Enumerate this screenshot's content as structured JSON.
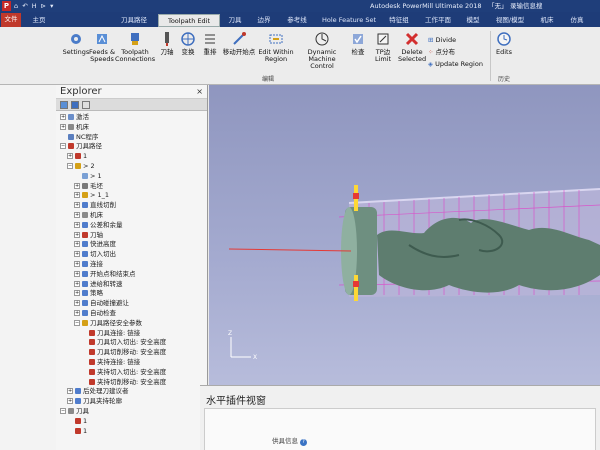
{
  "app": {
    "title": "Autodesk PowerMill Ultimate 2018",
    "title_suffix": "「无」",
    "right_text": "录输信息搜",
    "logo": "P",
    "quick_access": "⌂ ↶ H ⊳ ▾"
  },
  "tabs": [
    {
      "label": "文件"
    },
    {
      "label": "主页"
    },
    {
      "label": "刀具路径"
    },
    {
      "label": "Toolpath Edit"
    },
    {
      "label": "刀具"
    },
    {
      "label": "边界"
    },
    {
      "label": "参考线"
    },
    {
      "label": "Hole Feature Set"
    },
    {
      "label": "特征组"
    },
    {
      "label": "工作平面"
    },
    {
      "label": "模型"
    },
    {
      "label": "视图/模型"
    },
    {
      "label": "机床"
    },
    {
      "label": "仿真"
    }
  ],
  "ribbon": {
    "settings": "Settings",
    "feeds_speeds": "Feeds & Speeds",
    "toolpath_connections": "Toolpath Connections",
    "tool_axis": "刀轴",
    "transform": "变换",
    "reorder": "重排",
    "move_start": "移动开始点",
    "edit_within_region": "Edit Within Region",
    "dynamic_machine_control": "Dynamic Machine Control",
    "check": "检查",
    "tp_limit": "TP边Limit",
    "delete_selected": "Delete Selected",
    "divide": "Divide",
    "distribute": "点分布",
    "update_region": "Update Region",
    "edits": "Edits",
    "group_edit": "编辑",
    "group_history": "历史"
  },
  "explorer": {
    "title": "Explorer",
    "close": "×",
    "tree": [
      {
        "label": "激活",
        "indent": 0,
        "expander": "+",
        "icon": "#6b8ec9"
      },
      {
        "label": "机床",
        "indent": 0,
        "expander": "+",
        "icon": "#8a8a8a"
      },
      {
        "label": "NC程序",
        "indent": 0,
        "expander": "",
        "icon": "#5b7fbf"
      },
      {
        "label": "刀具路径",
        "indent": 0,
        "expander": "−",
        "icon": "#c0392b"
      },
      {
        "label": "1",
        "indent": 1,
        "expander": "+",
        "icon": "#c0392b"
      },
      {
        "label": "> 2",
        "indent": 1,
        "expander": "−",
        "icon": "#d4a017"
      },
      {
        "label": "> 1",
        "indent": 2,
        "expander": "",
        "icon": "#7aa0d4"
      },
      {
        "label": "毛坯",
        "indent": 2,
        "expander": "+",
        "icon": "#7a7a7a"
      },
      {
        "label": "> 1_1",
        "indent": 2,
        "expander": "+",
        "icon": "#d4a017"
      },
      {
        "label": "直线切削",
        "indent": 2,
        "expander": "+",
        "icon": "#4f7ccc"
      },
      {
        "label": "机床",
        "indent": 2,
        "expander": "+",
        "icon": "#8a8a8a"
      },
      {
        "label": "公差和余量",
        "indent": 2,
        "expander": "+",
        "icon": "#4f7ccc"
      },
      {
        "label": "刀轴",
        "indent": 2,
        "expander": "+",
        "icon": "#c0392b"
      },
      {
        "label": "快进高度",
        "indent": 2,
        "expander": "+",
        "icon": "#4f7ccc"
      },
      {
        "label": "切入切出",
        "indent": 2,
        "expander": "+",
        "icon": "#4f7ccc"
      },
      {
        "label": "连接",
        "indent": 2,
        "expander": "+",
        "icon": "#4f7ccc"
      },
      {
        "label": "开始点和结束点",
        "indent": 2,
        "expander": "+",
        "icon": "#4f7ccc"
      },
      {
        "label": "进给和转速",
        "indent": 2,
        "expander": "+",
        "icon": "#4f7ccc"
      },
      {
        "label": "策略",
        "indent": 2,
        "expander": "+",
        "icon": "#4f7ccc"
      },
      {
        "label": "自动碰撞避让",
        "indent": 2,
        "expander": "+",
        "icon": "#4f7ccc"
      },
      {
        "label": "自动检查",
        "indent": 2,
        "expander": "+",
        "icon": "#4f7ccc"
      },
      {
        "label": "刀具路径安全参数",
        "indent": 2,
        "expander": "−",
        "icon": "#d4a017"
      },
      {
        "label": "刀具连接: 链接",
        "indent": 3,
        "expander": "",
        "icon": "#c0392b"
      },
      {
        "label": "刀具切入切出: 安全高度",
        "indent": 3,
        "expander": "",
        "icon": "#c0392b"
      },
      {
        "label": "刀具切削移动: 安全高度",
        "indent": 3,
        "expander": "",
        "icon": "#c0392b"
      },
      {
        "label": "夹持连接: 链接",
        "indent": 3,
        "expander": "",
        "icon": "#c0392b"
      },
      {
        "label": "夹持切入切出: 安全高度",
        "indent": 3,
        "expander": "",
        "icon": "#c0392b"
      },
      {
        "label": "夹持切削移动: 安全高度",
        "indent": 3,
        "expander": "",
        "icon": "#c0392b"
      },
      {
        "label": "后处理刀建议者",
        "indent": 1,
        "expander": "+",
        "icon": "#4f7ccc"
      },
      {
        "label": "刀具夹持轮廓",
        "indent": 1,
        "expander": "+",
        "icon": "#4f7ccc"
      },
      {
        "label": "刀具",
        "indent": 0,
        "expander": "−",
        "icon": "#8a8a8a"
      },
      {
        "label": "1",
        "indent": 1,
        "expander": "",
        "icon": "#c0392b"
      },
      {
        "label": "1",
        "indent": 1,
        "expander": "",
        "icon": "#c0392b"
      }
    ]
  },
  "bottom_panel": {
    "title": "水平插件视窗",
    "tip": "供具信息"
  },
  "colors": {
    "titlebar": "#1f3e7a",
    "file_tab": "#c0392b",
    "viewport_top": "#8f96bf",
    "model": "#5e7d6f",
    "toolpath": "#e040c8"
  }
}
